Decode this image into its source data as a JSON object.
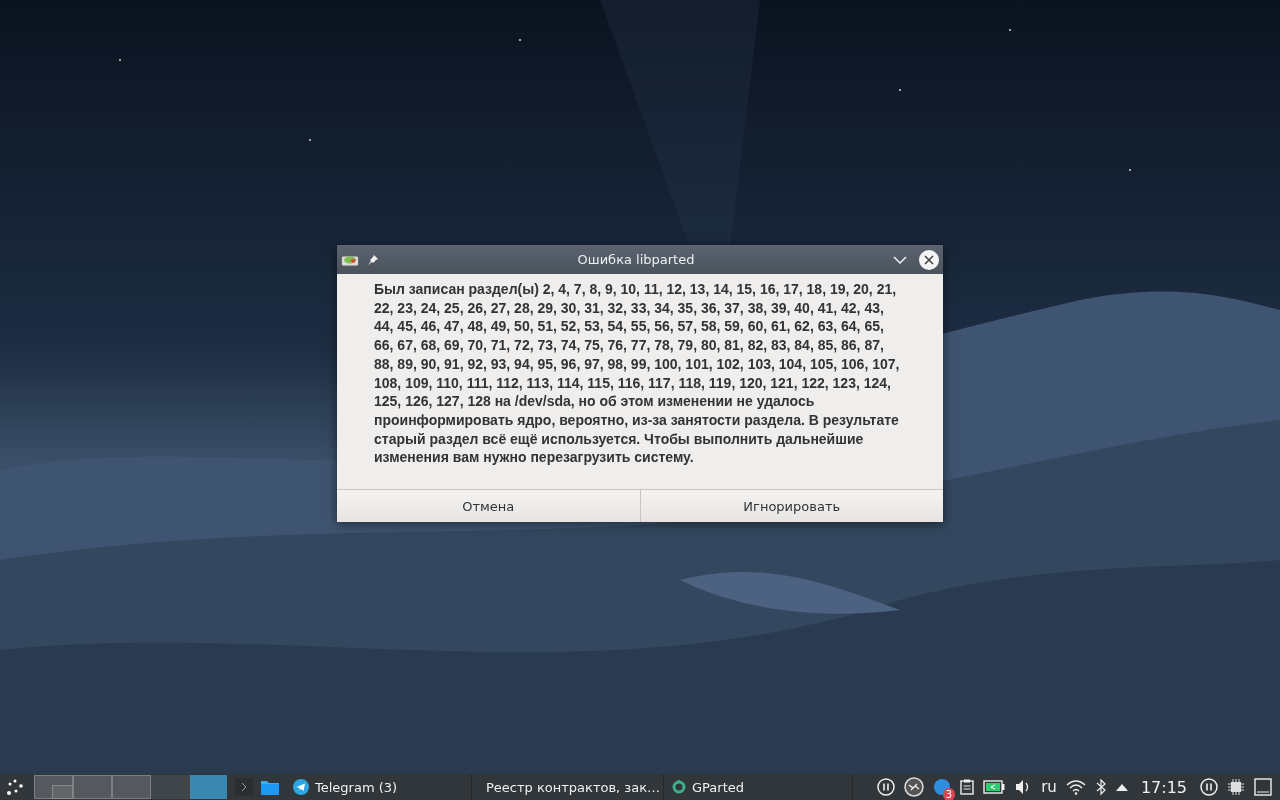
{
  "dialog": {
    "title": "Ошибка libparted",
    "message": "Был записан раздел(ы) 2, 4, 7, 8, 9, 10, 11, 12, 13, 14, 15, 16, 17, 18, 19, 20, 21, 22, 23, 24, 25, 26, 27, 28, 29, 30, 31, 32, 33, 34, 35, 36, 37, 38, 39, 40, 41, 42, 43, 44, 45, 46, 47, 48, 49, 50, 51, 52, 53, 54, 55, 56, 57, 58, 59, 60, 61, 62, 63, 64, 65, 66, 67, 68, 69, 70, 71, 72, 73, 74, 75, 76, 77, 78, 79, 80, 81, 82, 83, 84, 85, 86, 87, 88, 89, 90, 91, 92, 93, 94, 95, 96, 97, 98, 99, 100, 101, 102, 103, 104, 105, 106, 107, 108, 109, 110, 111, 112, 113, 114, 115, 116, 117, 118, 119, 120, 121, 122, 123, 124, 125, 126, 127, 128 на /dev/sda, но об этом изменении не удалось проинформировать ядро, вероятно, из-за занятости раздела. В результате старый раздел всё ещё используется. Чтобы выполнить дальнейшие изменения вам нужно перезагрузить систему.",
    "buttons": [
      "Отмена",
      "Игнорировать"
    ]
  },
  "taskbar": {
    "desktops": [
      {
        "selected": false,
        "has_window": true
      },
      {
        "selected": false,
        "has_window": false
      },
      {
        "selected": false,
        "has_window": false
      }
    ],
    "activity": {
      "selected": true
    },
    "tasks": [
      {
        "kind": "telegram",
        "label": "Telegram (3)"
      },
      {
        "kind": "browser",
        "label": "Реестр контрактов, зак…"
      },
      {
        "kind": "gparted",
        "label": "GParted"
      }
    ],
    "tray": {
      "badge": "3",
      "layout": "ru",
      "clock": "17:15"
    }
  }
}
